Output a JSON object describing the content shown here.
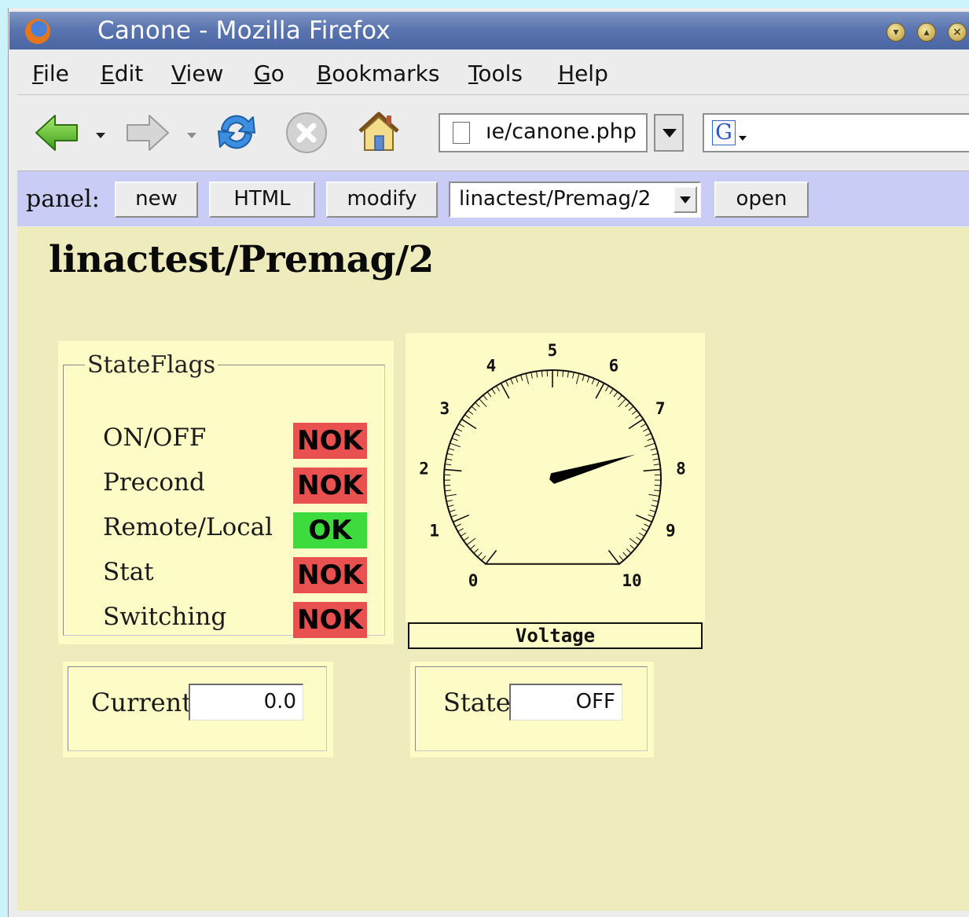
{
  "window": {
    "title": "Canone - Mozilla Firefox"
  },
  "menubar": {
    "items": [
      "File",
      "Edit",
      "View",
      "Go",
      "Bookmarks",
      "Tools",
      "Help"
    ]
  },
  "navbar": {
    "back_icon": "back-arrow-icon",
    "forward_icon": "forward-arrow-icon",
    "reload_icon": "reload-icon",
    "stop_icon": "stop-icon",
    "home_icon": "home-icon",
    "url": "ıe/canone.php",
    "search_value": ""
  },
  "panelbar": {
    "label": "panel:",
    "new_label": "new",
    "html_label": "HTML",
    "modify_label": "modify",
    "panel_select_value": "linactest/Premag/2",
    "open_label": "open"
  },
  "content": {
    "title": "linactest/Premag/2",
    "state_flags": {
      "legend": "StateFlags",
      "flags": [
        {
          "label": "ON/OFF",
          "status": "NOK",
          "color": "#e95050"
        },
        {
          "label": "Precond",
          "status": "NOK",
          "color": "#e95050"
        },
        {
          "label": "Remote/Local",
          "status": "OK",
          "color": "#3ddb3d"
        },
        {
          "label": "Stat",
          "status": "NOK",
          "color": "#e95050"
        },
        {
          "label": "Switching",
          "status": "NOK",
          "color": "#e95050"
        }
      ]
    },
    "gauge": {
      "caption": "Voltage",
      "scale_labels": [
        "0",
        "1",
        "2",
        "3",
        "4",
        "5",
        "6",
        "7",
        "8",
        "9",
        "10"
      ],
      "min": 0,
      "max": 10,
      "value": 7.6
    },
    "current": {
      "label": "Current",
      "value": "0.0"
    },
    "state": {
      "label": "State",
      "value": "OFF"
    }
  }
}
